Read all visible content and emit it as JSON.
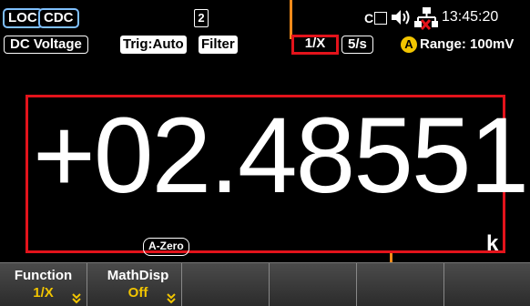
{
  "status": {
    "mode_loc": "LOC",
    "mode_cdc": "CDC",
    "memory_slot": "2",
    "ce_label": "C",
    "clock": "13:45:20"
  },
  "info": {
    "function": "DC Voltage",
    "trigger": "Trig:Auto",
    "filter": "Filter",
    "math": "1/X",
    "rate": "5/s",
    "range_badge": "A",
    "range": "Range: 100mV"
  },
  "reading": {
    "value": "+02.48551",
    "unit_prefix": "k",
    "azero": "A-Zero"
  },
  "softkeys": [
    {
      "label": "Function",
      "value": "1/X"
    },
    {
      "label": "MathDisp",
      "value": "Off"
    },
    {
      "label": "",
      "value": ""
    },
    {
      "label": "",
      "value": ""
    },
    {
      "label": "",
      "value": ""
    },
    {
      "label": "",
      "value": ""
    }
  ],
  "colors": {
    "highlight_box": "#e3131b",
    "annotation_line": "#f08a1a",
    "softkey_value": "#f2c500",
    "mode_border": "#7fc0ff"
  }
}
